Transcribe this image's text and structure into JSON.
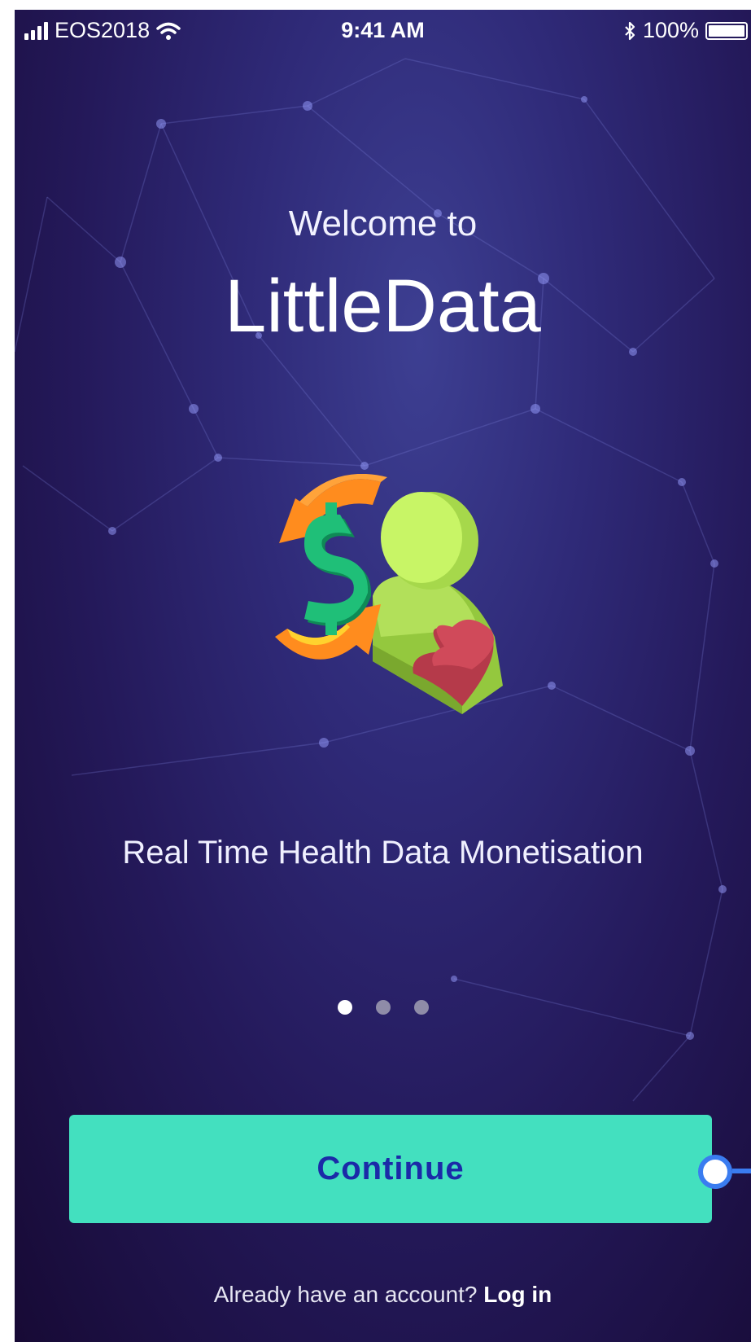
{
  "status_bar": {
    "carrier": "EOS2018",
    "time": "9:41 AM",
    "battery": "100%",
    "icons": [
      "signal-icon",
      "wifi-icon",
      "bluetooth-icon",
      "battery-icon"
    ]
  },
  "welcome": {
    "greeting": "Welcome to",
    "brand": "LittleData",
    "tagline": "Real Time Health Data Monetisation"
  },
  "pager": {
    "total": 3,
    "active_index": 0
  },
  "actions": {
    "continue_label": "Continue",
    "account_prompt": "Already have an account?",
    "login_label": "Log in"
  },
  "colors": {
    "background_top": "#3d3f92",
    "background_bottom": "#170a35",
    "button": "#43e0bf",
    "button_text": "#1b2aa8",
    "handle": "#3a7cf0"
  }
}
